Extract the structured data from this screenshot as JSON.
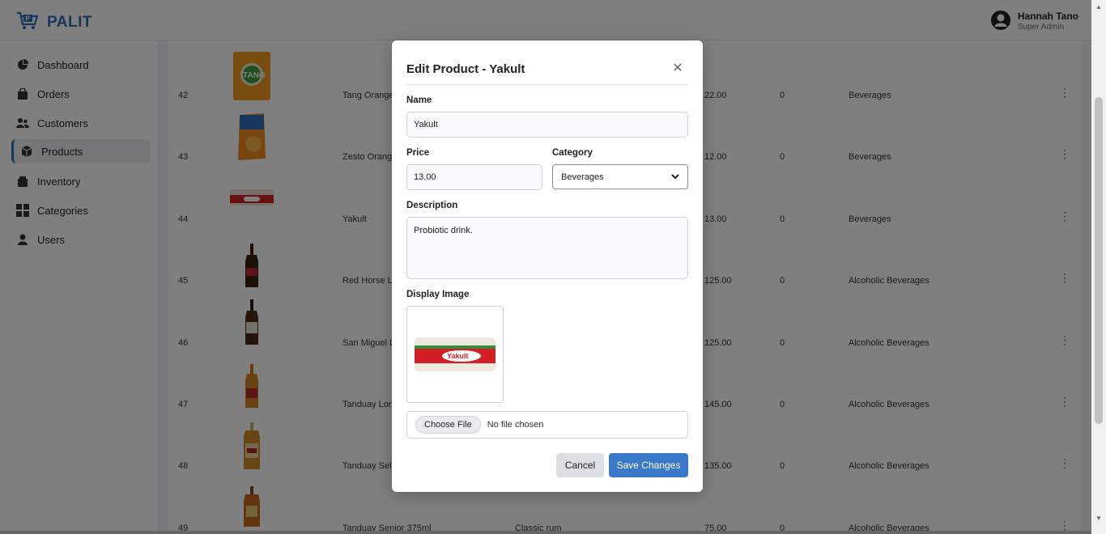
{
  "brand": {
    "name": "PALIT"
  },
  "user": {
    "name": "Hannah Tano",
    "role": "Super Admin"
  },
  "sidebar": {
    "items": [
      {
        "label": "Dashboard",
        "icon": "pie-chart-icon"
      },
      {
        "label": "Orders",
        "icon": "bag-icon"
      },
      {
        "label": "Customers",
        "icon": "users-icon"
      },
      {
        "label": "Products",
        "icon": "box-icon",
        "active": true
      },
      {
        "label": "Inventory",
        "icon": "inventory-icon"
      },
      {
        "label": "Categories",
        "icon": "grid-icon"
      },
      {
        "label": "Users",
        "icon": "user-icon"
      }
    ]
  },
  "table": {
    "rows": [
      {
        "id": "42",
        "name": "Tang Orange",
        "price": "22.00",
        "stock": "0",
        "category": "Beverages"
      },
      {
        "id": "43",
        "name": "Zesto Orange",
        "price": "12.00",
        "stock": "0",
        "category": "Beverages"
      },
      {
        "id": "44",
        "name": "Yakult",
        "price": "13.00",
        "stock": "0",
        "category": "Beverages"
      },
      {
        "id": "45",
        "name": "Red Horse Lit",
        "price": "125.00",
        "stock": "0",
        "category": "Alcoholic Beverages"
      },
      {
        "id": "46",
        "name": "San Miguel Li",
        "price": "125.00",
        "stock": "0",
        "category": "Alcoholic Beverages"
      },
      {
        "id": "47",
        "name": "Tanduay Long",
        "price": "145.00",
        "stock": "0",
        "category": "Alcoholic Beverages"
      },
      {
        "id": "48",
        "name": "Tanduay Sele",
        "price": "135.00",
        "stock": "0",
        "category": "Alcoholic Beverages"
      },
      {
        "id": "49",
        "name": "Tanduay Senior 375ml",
        "description": "Classic rum",
        "price": "75.00",
        "stock": "0",
        "category": "Alcoholic Beverages"
      }
    ]
  },
  "modal": {
    "title": "Edit Product - Yakult",
    "name_label": "Name",
    "name_value": "Yakult",
    "price_label": "Price",
    "price_value": "13.00",
    "category_label": "Category",
    "category_value": "Beverages",
    "description_label": "Description",
    "description_value": "Probiotic drink.",
    "image_label": "Display Image",
    "image_logo_text": "Yakult",
    "file_button": "Choose File",
    "file_status": "No file chosen",
    "cancel_label": "Cancel",
    "save_label": "Save Changes"
  },
  "colors": {
    "accent": "#2f6cb3",
    "save": "#3a78c9"
  }
}
